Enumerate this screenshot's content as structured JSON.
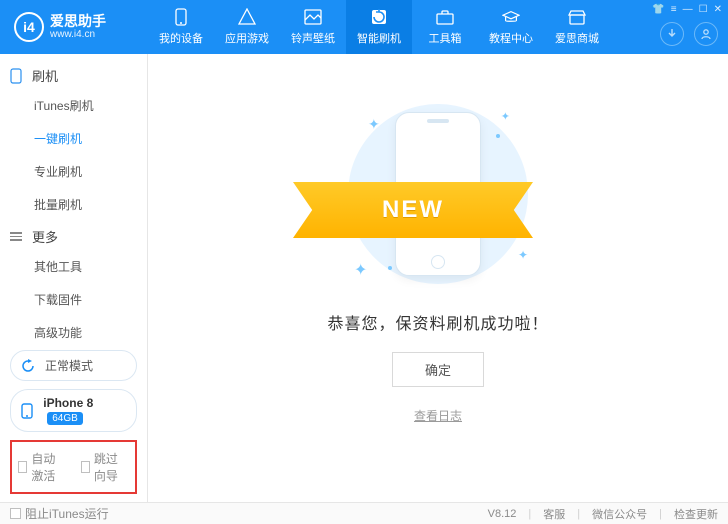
{
  "logo": {
    "badge": "i4",
    "title": "爱思助手",
    "url": "www.i4.cn"
  },
  "nav": [
    {
      "label": "我的设备"
    },
    {
      "label": "应用游戏"
    },
    {
      "label": "铃声壁纸"
    },
    {
      "label": "智能刷机"
    },
    {
      "label": "工具箱"
    },
    {
      "label": "教程中心"
    },
    {
      "label": "爱思商城"
    }
  ],
  "sidebar": {
    "group1": {
      "title": "刷机",
      "items": [
        "iTunes刷机",
        "一键刷机",
        "专业刷机",
        "批量刷机"
      ]
    },
    "group2": {
      "title": "更多",
      "items": [
        "其他工具",
        "下载固件",
        "高级功能"
      ]
    },
    "mode": "正常模式",
    "device": {
      "name": "iPhone 8",
      "storage": "64GB"
    },
    "cb1": "自动激活",
    "cb2": "跳过向导"
  },
  "main": {
    "ribbon": "NEW",
    "success": "恭喜您，保资料刷机成功啦！",
    "ok": "确定",
    "log": "查看日志"
  },
  "footer": {
    "block_itunes": "阻止iTunes运行",
    "version": "V8.12",
    "l1": "客服",
    "l2": "微信公众号",
    "l3": "检查更新"
  }
}
